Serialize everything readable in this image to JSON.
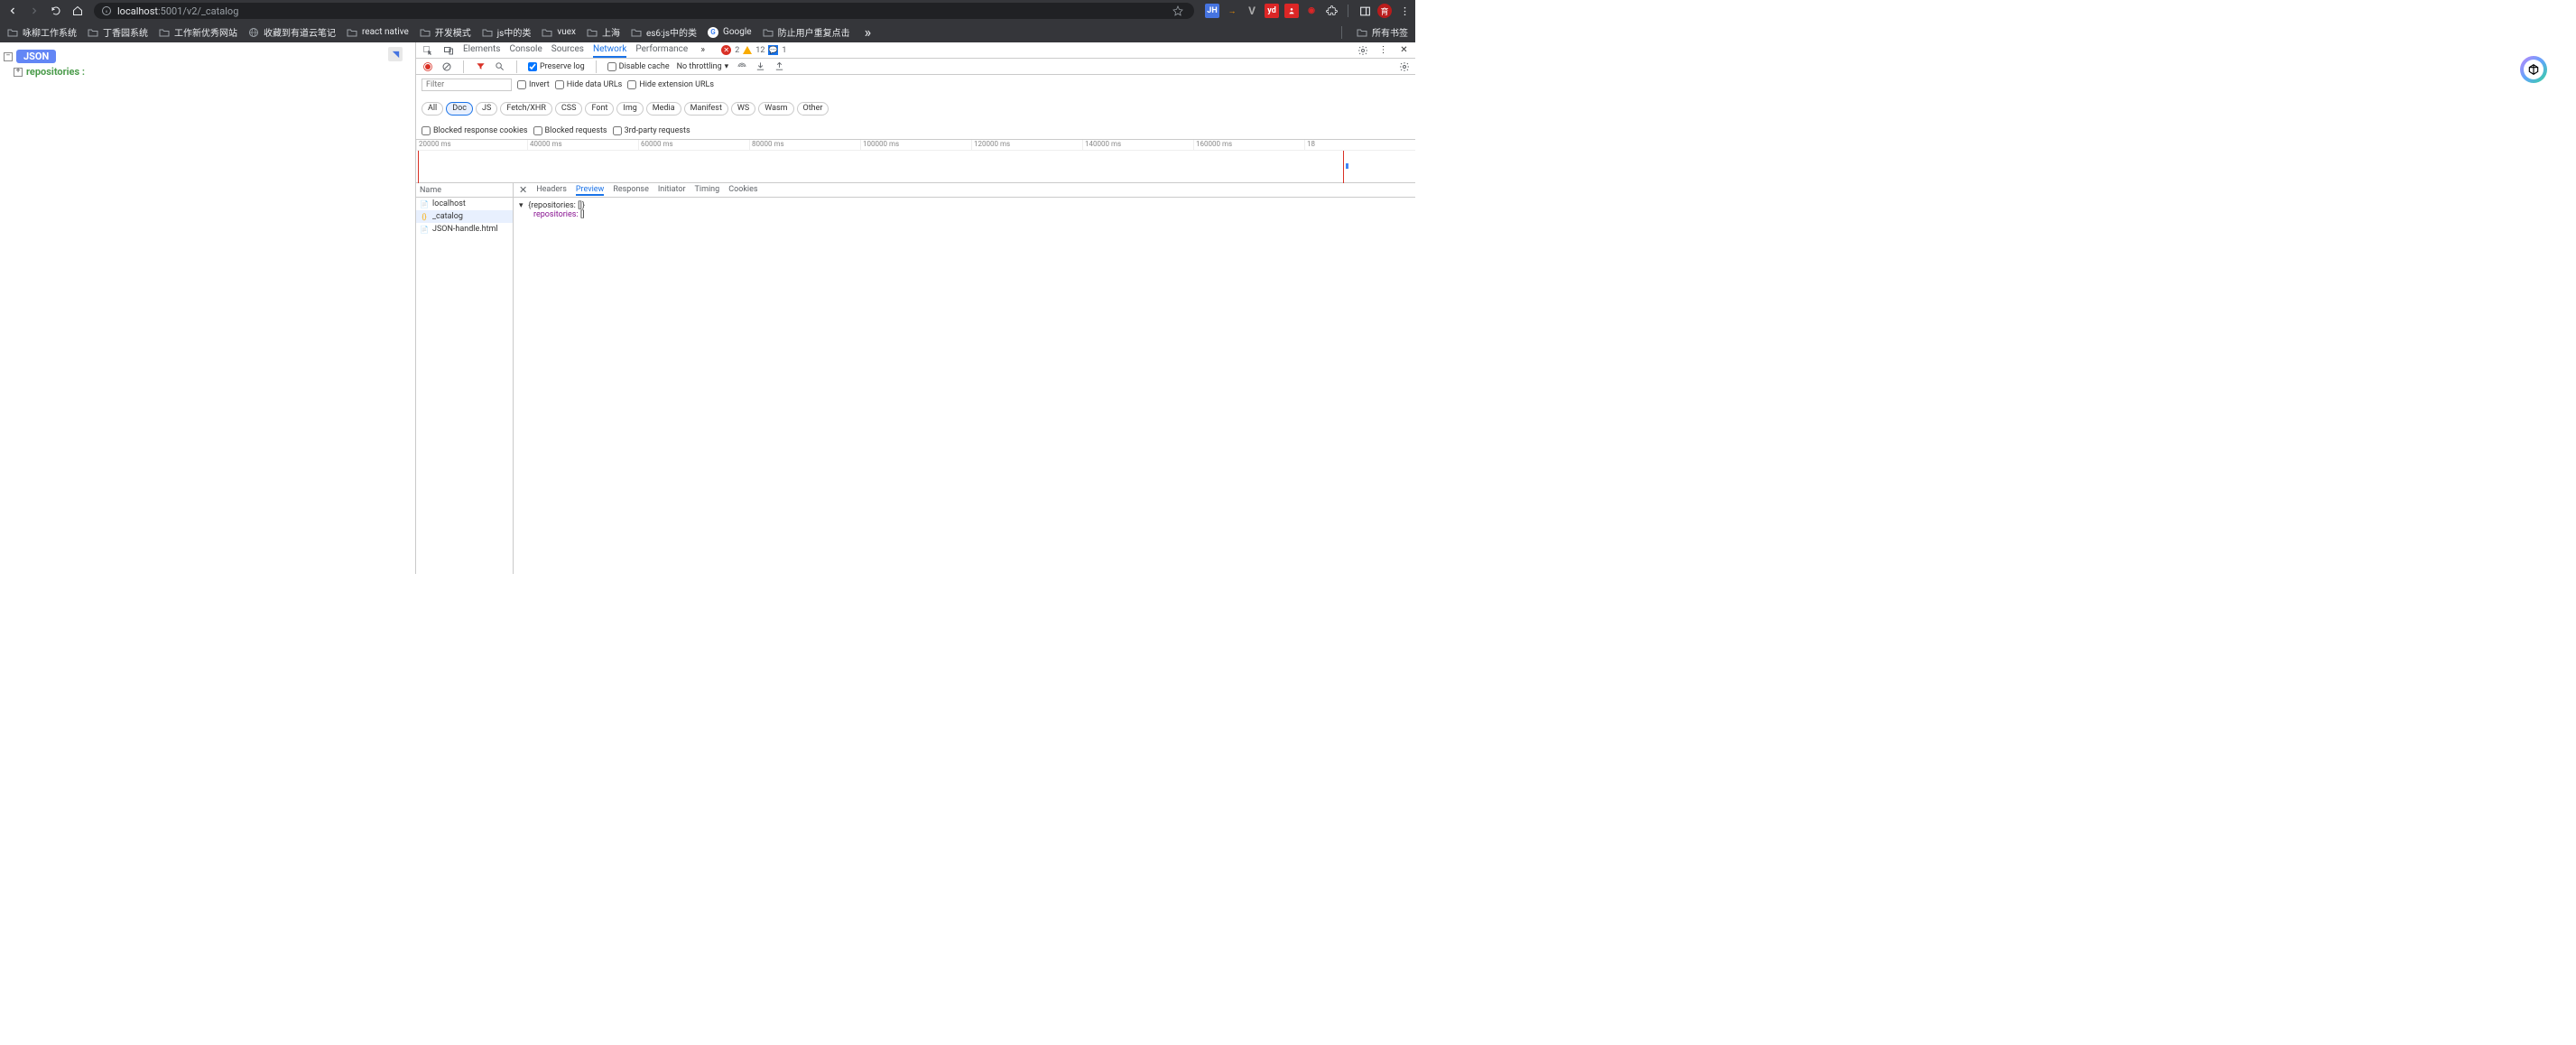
{
  "toolbar": {
    "url_host": "localhost",
    "url_port_path": ":5001/v2/_catalog",
    "avatar_text": "育",
    "ext_jh": "JH",
    "ext_v": "V",
    "ext_yd": "yd"
  },
  "bookmarks": {
    "items": [
      {
        "label": "咏柳工作系统",
        "type": "folder"
      },
      {
        "label": "丁香园系统",
        "type": "folder"
      },
      {
        "label": "工作新优秀网站",
        "type": "folder"
      },
      {
        "label": "收藏到有道云笔记",
        "type": "globe"
      },
      {
        "label": "react native",
        "type": "folder"
      },
      {
        "label": "开发模式",
        "type": "folder"
      },
      {
        "label": "js中的类",
        "type": "folder"
      },
      {
        "label": "vuex",
        "type": "folder"
      },
      {
        "label": "上海",
        "type": "folder"
      },
      {
        "label": "es6:js中的类",
        "type": "folder"
      },
      {
        "label": "Google",
        "type": "google"
      },
      {
        "label": "防止用户重复点击",
        "type": "folder"
      }
    ],
    "all_label": "所有书签"
  },
  "page": {
    "json_badge": "JSON",
    "json_key": "repositories :"
  },
  "devtools": {
    "tabs": [
      "Elements",
      "Console",
      "Sources",
      "Network",
      "Performance"
    ],
    "active_tab": "Network",
    "errors": "2",
    "warnings": "12",
    "issues": "1",
    "settings_gear": "⚙",
    "more": "⋮",
    "close": "✕"
  },
  "network": {
    "preserve_log": "Preserve log",
    "disable_cache": "Disable cache",
    "throttling": "No throttling",
    "filter_placeholder": "Filter",
    "invert": "Invert",
    "hide_data_urls": "Hide data URLs",
    "hide_ext_urls": "Hide extension URLs",
    "chips": [
      "All",
      "Doc",
      "JS",
      "Fetch/XHR",
      "CSS",
      "Font",
      "Img",
      "Media",
      "Manifest",
      "WS",
      "Wasm",
      "Other"
    ],
    "active_chip": "Doc",
    "blocked_cookies": "Blocked response cookies",
    "blocked_requests": "Blocked requests",
    "third_party": "3rd-party requests",
    "timeline_ticks": [
      "20000 ms",
      "40000 ms",
      "60000 ms",
      "80000 ms",
      "100000 ms",
      "120000 ms",
      "140000 ms",
      "160000 ms",
      "18"
    ],
    "name_header": "Name",
    "requests": [
      {
        "name": "localhost",
        "icon": "doc"
      },
      {
        "name": "_catalog",
        "icon": "json"
      },
      {
        "name": "JSON-handle.html",
        "icon": "doc"
      }
    ],
    "selected_request": "_catalog",
    "detail_tabs": [
      "Headers",
      "Preview",
      "Response",
      "Initiator",
      "Timing",
      "Cookies"
    ],
    "active_detail_tab": "Preview",
    "preview_line1": "{repositories: []}",
    "preview_key": "repositories",
    "preview_val": "[]"
  }
}
